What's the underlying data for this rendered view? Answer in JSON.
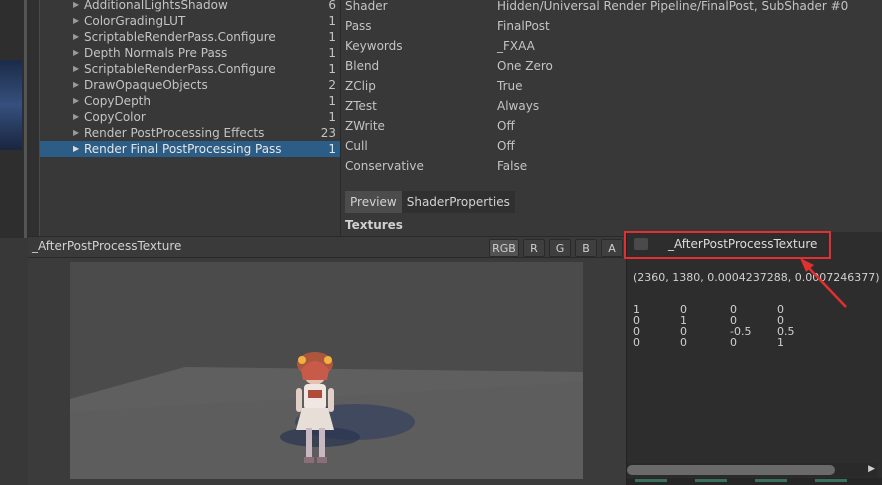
{
  "tree": {
    "rows": [
      {
        "label": "AdditionalLightsShadow",
        "count": "6"
      },
      {
        "label": "ColorGradingLUT",
        "count": "1"
      },
      {
        "label": "ScriptableRenderPass.Configure",
        "count": "1"
      },
      {
        "label": "Depth Normals Pre Pass",
        "count": "1"
      },
      {
        "label": "ScriptableRenderPass.Configure",
        "count": "1"
      },
      {
        "label": "DrawOpaqueObjects",
        "count": "2"
      },
      {
        "label": "CopyDepth",
        "count": "1"
      },
      {
        "label": "CopyColor",
        "count": "1"
      },
      {
        "label": "Render PostProcessing Effects",
        "count": "23"
      },
      {
        "label": "Render Final PostProcessing Pass",
        "count": "1"
      }
    ],
    "arrow_glyph": "▶"
  },
  "props": {
    "rows": [
      {
        "key": "Shader",
        "value": "Hidden/Universal Render Pipeline/FinalPost, SubShader #0"
      },
      {
        "key": "Pass",
        "value": "FinalPost"
      },
      {
        "key": "Keywords",
        "value": "_FXAA"
      },
      {
        "key": "Blend",
        "value": "One Zero"
      },
      {
        "key": "ZClip",
        "value": "True"
      },
      {
        "key": "ZTest",
        "value": "Always"
      },
      {
        "key": "ZWrite",
        "value": "Off"
      },
      {
        "key": "Cull",
        "value": "Off"
      },
      {
        "key": "Conservative",
        "value": "False"
      }
    ],
    "tabs": {
      "preview": "Preview",
      "shader_properties": "ShaderProperties"
    },
    "section_title": "Textures"
  },
  "texture_view": {
    "title": "_AfterPostProcessTexture",
    "channels": {
      "rgb": "RGB",
      "r": "R",
      "g": "G",
      "b": "B",
      "a": "A"
    }
  },
  "texture_info": {
    "name": "_AfterPostProcessTexture",
    "dims": "(2360, 1380, 0.0004237288, 0.0007246377)",
    "matrix": [
      [
        "1",
        "0",
        "0",
        "0"
      ],
      [
        "0",
        "1",
        "0",
        "0"
      ],
      [
        "0",
        "0",
        "-0.5",
        "0.5"
      ],
      [
        "0",
        "0",
        "0",
        "1"
      ]
    ],
    "scroll_arrow": "▶"
  },
  "colors": {
    "selection": "#2c5d87",
    "highlight_box": "#e03030",
    "panel_bg": "#383838"
  }
}
